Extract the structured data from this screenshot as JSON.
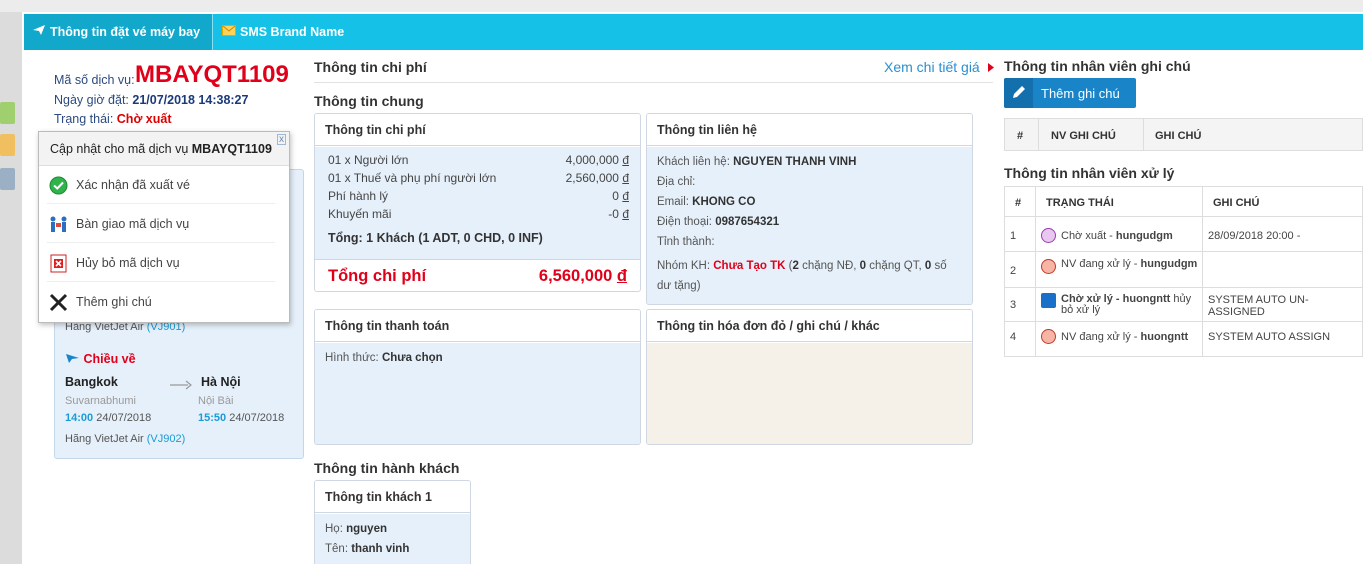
{
  "tabs": [
    {
      "label": "Thông tin đặt vé máy bay",
      "icon": "plane-icon"
    },
    {
      "label": "SMS Brand Name",
      "icon": "mail-icon"
    }
  ],
  "service": {
    "code_label": "Mã số dịch vụ:",
    "code": "MBAYQT1109",
    "datetime_label": "Ngày giờ đặt:",
    "datetime": "21/07/2018 14:38:27",
    "status_label": "Trạng thái:",
    "status": "Chờ xuất"
  },
  "popup": {
    "title_prefix": "Cập nhật cho mã dịch vụ",
    "title_code": "MBAYQT1109",
    "close": "x",
    "items": [
      {
        "label": "Xác nhận đã xuất vé",
        "icon": "check-circle-icon"
      },
      {
        "label": "Bàn giao mã dịch vụ",
        "icon": "handover-icon"
      },
      {
        "label": "Hủy bỏ mã dịch vụ",
        "icon": "cancel-doc-icon"
      },
      {
        "label": "Thêm ghi chú",
        "icon": "note-icon"
      }
    ]
  },
  "flight": {
    "outbound_airline": "Hãng VietJet Air",
    "outbound_code": "(VJ901)",
    "return_label": "Chiều về",
    "from_city": "Bangkok",
    "from_airport": "Suvarnabhumi",
    "dep_time": "14:00",
    "dep_date": "24/07/2018",
    "to_city": "Hà Nội",
    "to_airport": "Nội Bài",
    "arr_time": "15:50",
    "arr_date": "24/07/2018",
    "return_airline": "Hãng VietJet Air",
    "return_code": "(VJ902)"
  },
  "cost": {
    "heading": "Thông tin chi phí",
    "detail_link": "Xem chi tiết giá",
    "general_heading": "Thông tin chung",
    "box_title": "Thông tin chi phí",
    "lines": [
      {
        "label": "01 x Người lớn",
        "value": "4,000,000",
        "cur": "đ"
      },
      {
        "label": "01 x Thuế và phụ phí người lớn",
        "value": "2,560,000",
        "cur": "đ"
      },
      {
        "label": "Phí hành lý",
        "value": "0",
        "cur": "đ"
      },
      {
        "label": "Khuyến mãi",
        "value": "-0",
        "cur": "đ"
      }
    ],
    "summary": "Tổng: 1 Khách (1 ADT, 0 CHD, 0 INF)",
    "total_label": "Tổng chi phí",
    "total_value": "6,560,000",
    "total_cur": "đ"
  },
  "contact": {
    "box_title": "Thông tin liên hệ",
    "name_label": "Khách liên hệ:",
    "name": "NGUYEN THANH VINH",
    "address_label": "Địa chỉ:",
    "email_label": "Email:",
    "email": "KHONG CO",
    "phone_label": "Điện thoại:",
    "phone": "0987654321",
    "city_label": "Tỉnh thành:",
    "group_label": "Nhóm KH:",
    "group_value": "Chưa Tạo TK",
    "group_p1": "(",
    "group_n1": "2",
    "group_t1": "chặng NĐ,",
    "group_n2": "0",
    "group_t2": "chặng QT,",
    "group_n3": "0",
    "group_t3": "số dư",
    "group_t4": "tặng)"
  },
  "payment": {
    "box_title": "Thông tin thanh toán",
    "method_label": "Hình thức:",
    "method": "Chưa chọn"
  },
  "invoice": {
    "box_title": "Thông tin hóa đơn đỏ / ghi chú / khác"
  },
  "passengers": {
    "heading": "Thông tin hành khách",
    "box_title": "Thông tin khách 1",
    "last_label": "Họ:",
    "last": "nguyen",
    "first_label": "Tên:",
    "first": "thanh vinh"
  },
  "notes": {
    "heading": "Thông tin nhân viên ghi chú",
    "add_button": "Thêm ghi chú",
    "columns": [
      "#",
      "NV GHI CHÚ",
      "GHI CHÚ"
    ]
  },
  "processing": {
    "heading": "Thông tin nhân viên xử lý",
    "columns": [
      "#",
      "TRẠNG THÁI",
      "GHI CHÚ"
    ],
    "rows": [
      {
        "num": "1",
        "status": "Chờ xuất",
        "sep": " - ",
        "user": "hungudgm",
        "extra": "",
        "note": "28/09/2018 20:00 -",
        "icon": "pending-face-icon"
      },
      {
        "num": "2",
        "status": "NV đang xử lý",
        "sep": " - ",
        "user": "hungudgm",
        "extra": "",
        "note": "",
        "icon": "staff-face-icon"
      },
      {
        "num": "3",
        "status": "Chờ xử lý",
        "sep": " - ",
        "user": "huongntt",
        "extra": "hủy bỏ xử lý",
        "note": "SYSTEM AUTO UN-ASSIGNED",
        "icon": "person-info-icon"
      },
      {
        "num": "4",
        "status": "NV đang xử lý",
        "sep": " - ",
        "user": "huongntt",
        "extra": "",
        "note": "SYSTEM AUTO ASSIGN",
        "icon": "staff-face-icon"
      }
    ]
  }
}
